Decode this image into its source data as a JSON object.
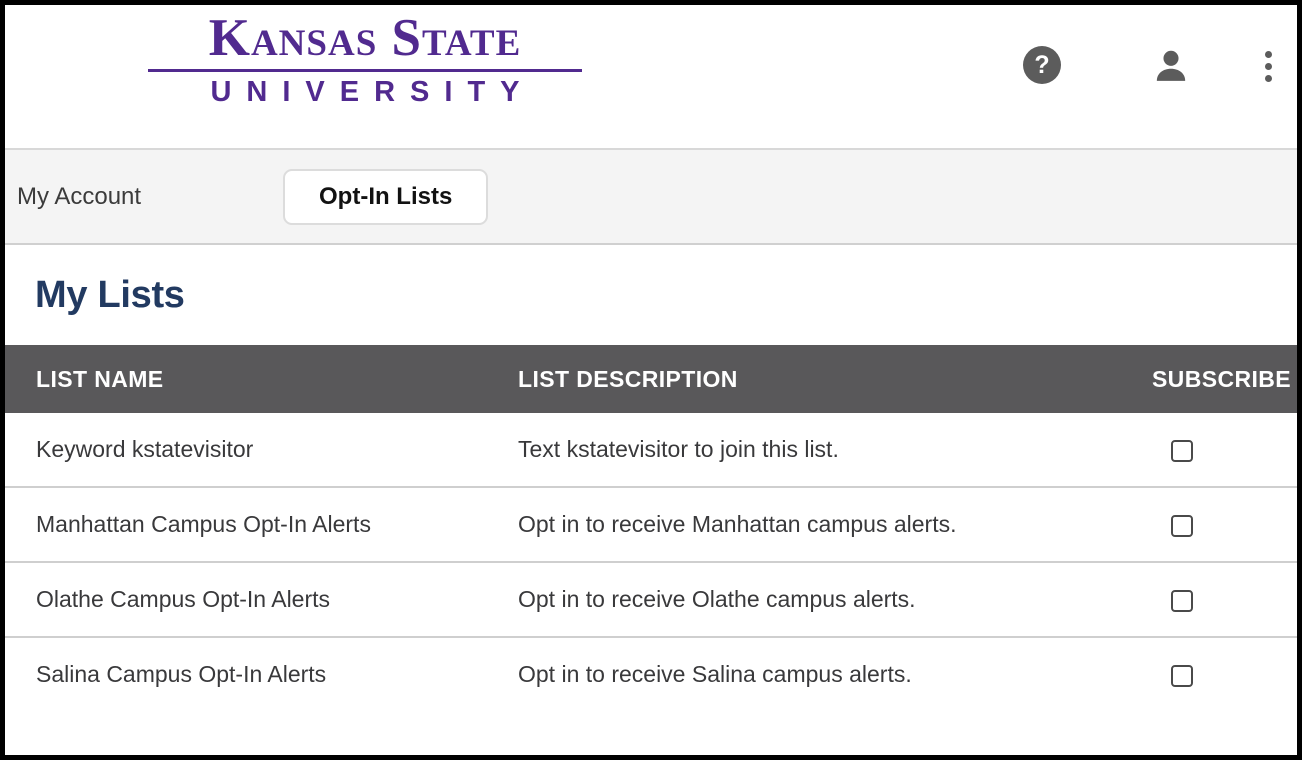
{
  "brand": {
    "logo_main": "Kansas State",
    "logo_sub": "UNIVERSITY",
    "purple": "#512a8f"
  },
  "header_icons": {
    "help": "?",
    "help_name": "help-icon",
    "account_name": "account-icon",
    "menu_name": "overflow-menu-icon",
    "icon_color": "#5c5c5c"
  },
  "nav": {
    "account_label": "My Account",
    "optin_button_label": "Opt-In Lists"
  },
  "main": {
    "page_title": "My Lists",
    "title_color": "#223a61",
    "table": {
      "header_bg": "#59585a",
      "columns": [
        "LIST NAME",
        "LIST DESCRIPTION",
        "SUBSCRIBE"
      ],
      "rows": [
        {
          "name": "Keyword kstatevisitor",
          "description": "Text kstatevisitor to join this list.",
          "subscribed": false
        },
        {
          "name": "Manhattan Campus Opt-In Alerts",
          "description": "Opt in to receive Manhattan campus alerts.",
          "subscribed": false
        },
        {
          "name": "Olathe Campus Opt-In Alerts",
          "description": "Opt in to receive Olathe campus alerts.",
          "subscribed": false
        },
        {
          "name": "Salina Campus Opt-In Alerts",
          "description": "Opt in to receive Salina campus alerts.",
          "subscribed": false
        }
      ]
    }
  }
}
